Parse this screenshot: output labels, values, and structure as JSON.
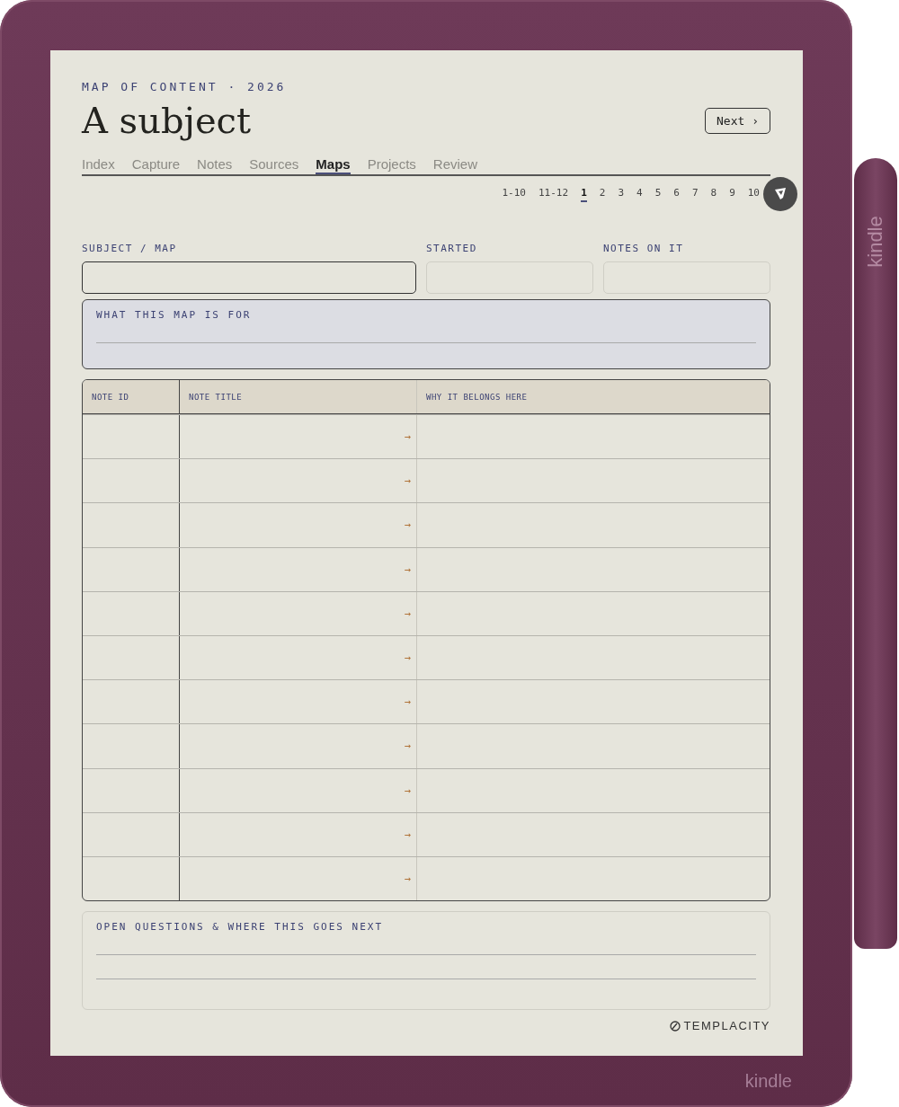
{
  "header": {
    "eyebrow": "MAP OF CONTENT · 2026",
    "title": "A subject",
    "next_button": "Next ›"
  },
  "tabs": [
    {
      "label": "Index",
      "selected": false
    },
    {
      "label": "Capture",
      "selected": false
    },
    {
      "label": "Notes",
      "selected": false
    },
    {
      "label": "Sources",
      "selected": false
    },
    {
      "label": "Maps",
      "selected": true
    },
    {
      "label": "Projects",
      "selected": false
    },
    {
      "label": "Review",
      "selected": false
    }
  ],
  "pagination": [
    {
      "label": "1-10",
      "selected": false
    },
    {
      "label": "11-12",
      "selected": false
    },
    {
      "label": "1",
      "selected": true
    },
    {
      "label": "2",
      "selected": false
    },
    {
      "label": "3",
      "selected": false
    },
    {
      "label": "4",
      "selected": false
    },
    {
      "label": "5",
      "selected": false
    },
    {
      "label": "6",
      "selected": false
    },
    {
      "label": "7",
      "selected": false
    },
    {
      "label": "8",
      "selected": false
    },
    {
      "label": "9",
      "selected": false
    },
    {
      "label": "10",
      "selected": false
    }
  ],
  "fields": [
    {
      "label": "SUBJECT / MAP",
      "selected": true
    },
    {
      "label": "STARTED",
      "selected": false
    },
    {
      "label": "NOTES ON IT",
      "selected": false
    }
  ],
  "purpose_box": {
    "label": "WHAT THIS MAP IS FOR"
  },
  "table": {
    "columns": [
      "NOTE ID",
      "NOTE TITLE",
      "WHY IT BELONGS HERE"
    ],
    "rows": [
      {
        "arrow": "→"
      },
      {
        "arrow": "→"
      },
      {
        "arrow": "→"
      },
      {
        "arrow": "→"
      },
      {
        "arrow": "→"
      },
      {
        "arrow": "→"
      },
      {
        "arrow": "→"
      },
      {
        "arrow": "→"
      },
      {
        "arrow": "→"
      },
      {
        "arrow": "→"
      },
      {
        "arrow": "→"
      }
    ]
  },
  "questions_box": {
    "label": "OPEN QUESTIONS & WHERE THIS GOES NEXT"
  },
  "footer": {
    "brand": "TEMPLACITY"
  },
  "device": {
    "brand": "kindle",
    "pen_brand": "kindle"
  }
}
